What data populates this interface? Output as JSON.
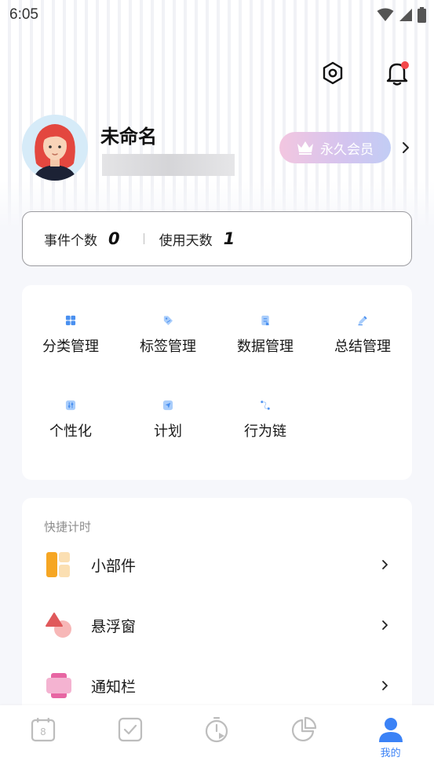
{
  "status_bar": {
    "time": "6:05"
  },
  "header": {
    "settings_icon": "hexagon-gear-icon",
    "notification_icon": "bell-icon",
    "has_notification": true
  },
  "profile": {
    "name": "未命名",
    "vip_label": "永久会员"
  },
  "stats": [
    {
      "label": "事件个数",
      "value": "0"
    },
    {
      "label": "使用天数",
      "value": "1"
    }
  ],
  "features": [
    {
      "label": "分类管理",
      "icon": "category-grid-icon"
    },
    {
      "label": "标签管理",
      "icon": "tag-icon"
    },
    {
      "label": "数据管理",
      "icon": "data-icon"
    },
    {
      "label": "总结管理",
      "icon": "pen-icon"
    },
    {
      "label": "个性化",
      "icon": "sliders-icon"
    },
    {
      "label": "计划",
      "icon": "send-icon"
    },
    {
      "label": "行为链",
      "icon": "chain-icon"
    }
  ],
  "quick": {
    "title": "快捷计时",
    "items": [
      {
        "label": "小部件",
        "icon": "widget-icon"
      },
      {
        "label": "悬浮窗",
        "icon": "floating-window-icon"
      },
      {
        "label": "通知栏",
        "icon": "notification-bar-icon"
      }
    ]
  },
  "tabs": [
    {
      "label": "",
      "icon": "calendar-icon"
    },
    {
      "label": "",
      "icon": "checkbox-icon"
    },
    {
      "label": "",
      "icon": "timer-icon"
    },
    {
      "label": "",
      "icon": "pie-chart-icon"
    },
    {
      "label": "我的",
      "icon": "user-icon",
      "active": true
    }
  ],
  "colors": {
    "accent": "#3b82f6",
    "icon_blue": "#4a90f0",
    "icon_light": "#a9cdfb",
    "notification": "#f3484a"
  }
}
